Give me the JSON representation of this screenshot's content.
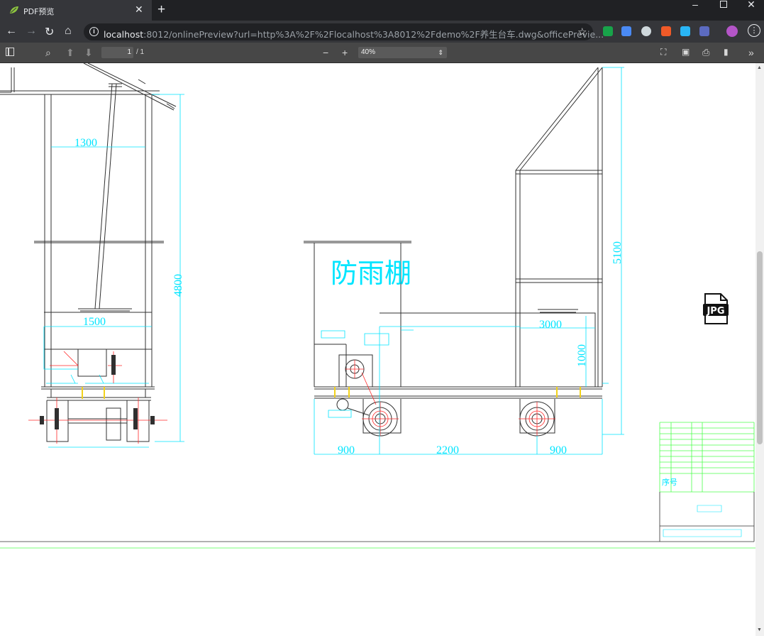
{
  "browser": {
    "tab_title": "PDF预览",
    "url_host": "localhost",
    "url_rest": ":8012/onlinePreview?url=http%3A%2F%2Flocalhost%3A8012%2Fdemo%2F养生台车.dwg&officePrevie...",
    "colors": {
      "tabbar": "#202124",
      "toolbar": "#35363a",
      "omnibox": "#202124"
    }
  },
  "pdf_toolbar": {
    "page_value": "1",
    "page_count": "/ 1",
    "zoom_value": "40%",
    "colors": {
      "bar": "#474747"
    }
  },
  "drawing": {
    "title_text": "防雨棚",
    "dims_left": [
      "1300",
      "1500",
      "4800"
    ],
    "dims_right": [
      "5100",
      "3000",
      "1000",
      "900",
      "2200",
      "900"
    ],
    "table_header": "序号",
    "colors": {
      "line": "#303030",
      "dimension": "#00e5ff",
      "accent_red": "#ff2a2a",
      "accent_yellow": "#f2d21b",
      "table": "#4cff4c"
    }
  },
  "overlay": {
    "file_icon": "jpg-file-icon",
    "file_icon_label": "JPG"
  }
}
